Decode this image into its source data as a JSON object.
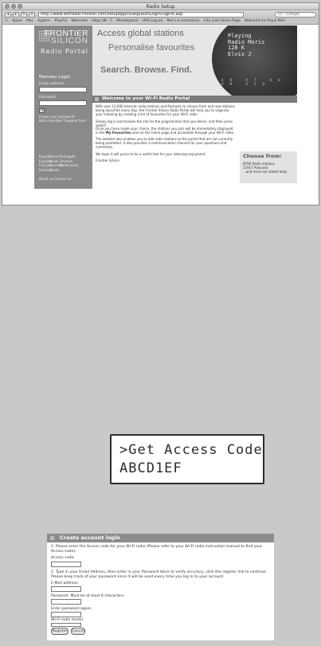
{
  "browser": {
    "title": "Radio Setup",
    "url": "http://www.wifiradio-frontier.com/setupapp/fs/asp/AuthLogin/SignIn.asp",
    "search_placeholder": "Q~ Google",
    "bookmarks": [
      "Apple",
      "Mac",
      "Apple+",
      "PlayFul",
      "Welcome",
      "eBay UK - T",
      "Marketplace",
      "UPS Log-on",
      "Mel's e-commerce",
      "City Link Home Page",
      "Welcome to Royal Mail"
    ]
  },
  "portal": {
    "logo": {
      "line1": "FRONTIER",
      "line2": "SILICON",
      "line3": "Radio Portal"
    },
    "login": {
      "title": "Member Login",
      "email_label": "Email address",
      "password_label": "Password",
      "forgot": "Forgot your password?",
      "not_member": "Not a member? Register here"
    },
    "languages": [
      "English",
      "Dansk",
      "Português",
      "Español",
      "Norsk",
      "Deutsch",
      "Français",
      "Svenska",
      "Nederlands",
      "Deutsch",
      "Suomi",
      ""
    ],
    "footer_links": "About us   Contact us",
    "banner": {
      "line1": "Access global stations",
      "line2": "Personalise favourites",
      "line3": "Search. Browse. Find.",
      "radio_display": [
        "Playing",
        "Radio Moris",
        "128 K",
        "Elvis J"
      ],
      "radio_numbers": "09 07 08 09 010"
    },
    "welcome": {
      "title": "Welcome to your Wi-Fi Radio Portal",
      "p1": "With over 15,000 Internet radio stations and Podcasts to choose from and new stations being launched every day, the Frontier Silicon Radio Portal will help you to organise your listening by creating a list of favourites for your Wi-Fi radio",
      "p2": "Simply log in and browse the site for the programmes that you desire, and then press select!",
      "p3_pre": "Once you have made your choice, the stations you pick will be immediately displayed in the ",
      "p3_bold": "My Favourites",
      "p3_post": " area on the home page and accessible through your Wi-Fi radio.",
      "p4": "The website also enables you to add radio stations to the portal that are not currently being promoted. It also provides a communication channel for your questions and comments.",
      "p5": "We hope it will prove to be a useful tool for your listening enjoyment.",
      "sign": "Frontier Silicon"
    },
    "choose": {
      "title": "Choose from:",
      "line1": "8796 Radio stations",
      "line2": "11917 Podcasts",
      "line3": "...and more are added daily"
    }
  },
  "lcd": {
    "line1": ">Get Access Code",
    "line2": "ABCD1EF"
  },
  "form": {
    "title": "Create account login",
    "step1": "1. Please enter the Access code for your Wi-Fi radio (Please refer to your Wi-Fi radio instruction manual to find your Access code):",
    "access_label": "Access code:",
    "step2": "2. Type in your Email Address, then enter in your Password twice to verify accuracy, click the register link to continue. Please keep track of your password since it will be used every time you log in to your account.",
    "email_label": "E-Mail address:",
    "password_label": "Password: Must be at least 6 characters",
    "password2_label": "Enter password again :",
    "model_label": "Wi-Fi radio model",
    "register": "Register",
    "cancel": "Cancel"
  }
}
